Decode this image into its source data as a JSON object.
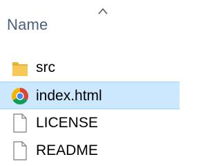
{
  "header": {
    "column_label": "Name",
    "sort_direction": "ascending"
  },
  "files": [
    {
      "name": "src",
      "icon": "folder-icon",
      "selected": false
    },
    {
      "name": "index.html",
      "icon": "chrome-icon",
      "selected": true
    },
    {
      "name": "LICENSE",
      "icon": "document-icon",
      "selected": false
    },
    {
      "name": "README",
      "icon": "document-icon",
      "selected": false
    }
  ],
  "colors": {
    "selection_fill": "#cce8ff",
    "selection_border": "#99d1ff",
    "header_text": "#4c607a",
    "folder": "#f6c858"
  }
}
